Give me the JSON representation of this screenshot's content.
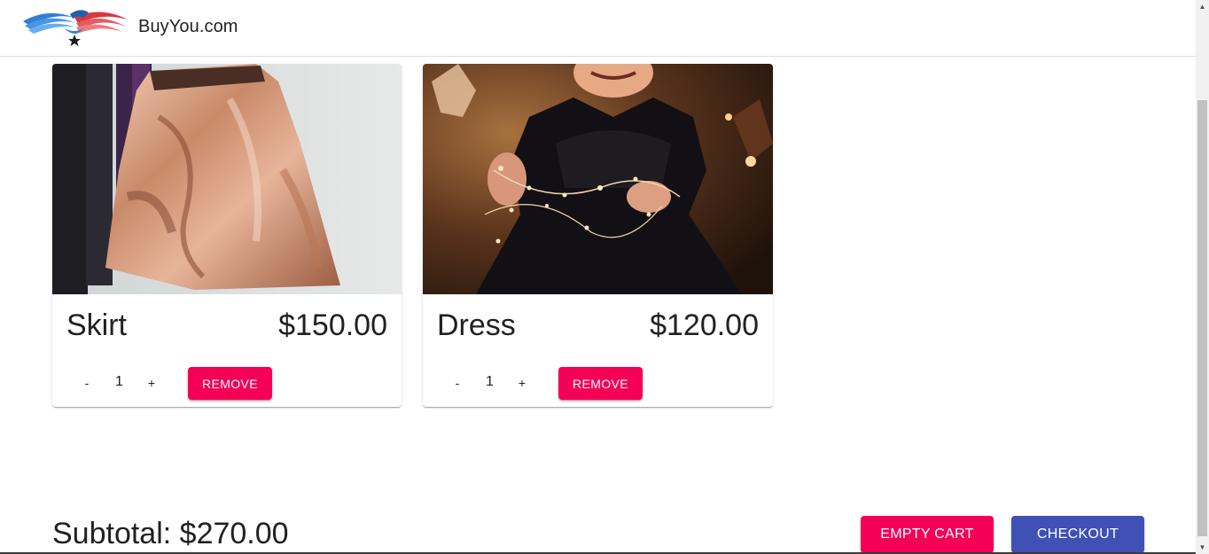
{
  "header": {
    "brand": "BuyYou.com",
    "logo_icon": "eagle-flag-logo-icon"
  },
  "cart": {
    "items": [
      {
        "name": "Skirt",
        "price": "$150.00",
        "quantity": "1",
        "decrement_label": "-",
        "increment_label": "+",
        "remove_label": "REMOVE",
        "image": "sequin-skirt-photo"
      },
      {
        "name": "Dress",
        "price": "$120.00",
        "quantity": "1",
        "decrement_label": "-",
        "increment_label": "+",
        "remove_label": "REMOVE",
        "image": "girl-black-dress-photo"
      }
    ],
    "subtotal_label": "Subtotal:",
    "subtotal_value": "$270.00",
    "empty_cart_label": "EMPTY CART",
    "checkout_label": "CHECKOUT"
  },
  "colors": {
    "secondary": "#f50057",
    "primary": "#3f51b5"
  }
}
